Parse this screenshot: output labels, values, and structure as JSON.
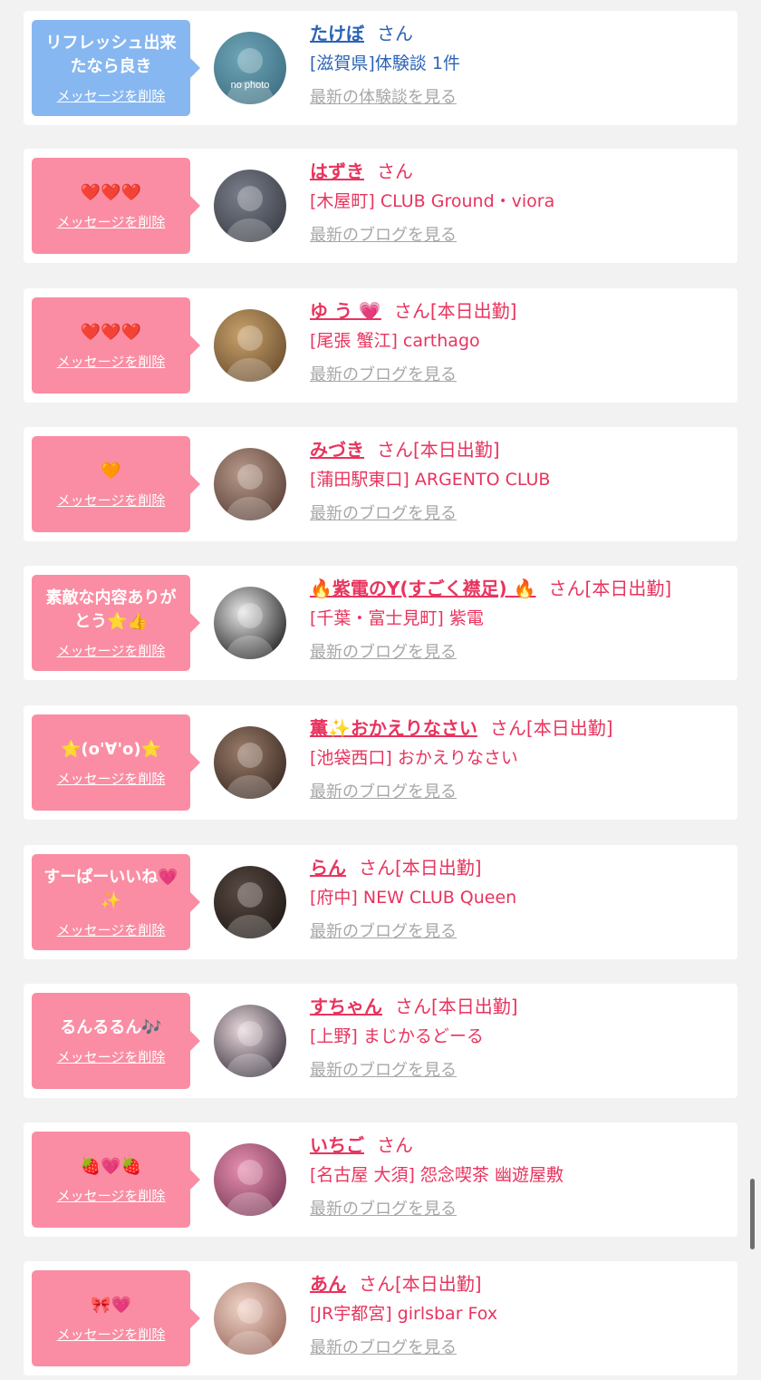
{
  "colors": {
    "background": "#f2f2f2",
    "card": "#ffffff",
    "pink_bubble": "#fa8da3",
    "blue_bubble": "#87b7f0",
    "pink_text": "#e8345e",
    "blue_text": "#2b63b6",
    "link_gray": "#a7a7a7"
  },
  "delete_label": "メッセージを削除",
  "cards": [
    {
      "message": "リフレッシュ出来\nたなら良き",
      "bubble": "blue",
      "avatar_text": "no photo",
      "name": "たけぼ",
      "san": "さん",
      "status": "",
      "detail": "[滋賀県]体験談 1件",
      "link": "最新の体験談を見る",
      "theme": "blue"
    },
    {
      "message": "❤️❤️❤️",
      "bubble": "pink",
      "name": "はずき",
      "san": "さん",
      "status": "",
      "detail": "[木屋町] CLUB Ground・viora",
      "link": "最新のブログを見る",
      "theme": "pink"
    },
    {
      "message": "❤️❤️❤️",
      "bubble": "pink",
      "name": "ゆ う 💗",
      "san": "さん",
      "status": "[本日出勤]",
      "detail": "[尾張 蟹江] carthago",
      "link": "最新のブログを見る",
      "theme": "pink"
    },
    {
      "message": "🧡",
      "bubble": "pink",
      "name": "みづき",
      "san": "さん",
      "status": "[本日出勤]",
      "detail": "[蒲田駅東口] ARGENTO CLUB",
      "link": "最新のブログを見る",
      "theme": "pink"
    },
    {
      "message": "素敵な内容ありが\nとう⭐️👍",
      "bubble": "pink",
      "name": "🔥紫電のY(すごく襟足) 🔥",
      "san": "さん",
      "status": "[本日出勤]",
      "detail": "[千葉・富士見町] 紫電",
      "link": "最新のブログを見る",
      "theme": "pink"
    },
    {
      "message": "⭐️(o'∀'o)⭐️",
      "bubble": "pink",
      "name": "薫✨おかえりなさい",
      "san": "さん",
      "status": "[本日出勤]",
      "detail": "[池袋西口] おかえりなさい",
      "link": "最新のブログを見る",
      "theme": "pink"
    },
    {
      "message": "すーぱーいいね💗\n✨",
      "bubble": "pink",
      "name": "らん",
      "san": "さん",
      "status": "[本日出勤]",
      "detail": "[府中] NEW CLUB Queen",
      "link": "最新のブログを見る",
      "theme": "pink"
    },
    {
      "message": "るんるるん🎶",
      "bubble": "pink",
      "name": "すちゃん",
      "san": "さん",
      "status": "[本日出勤]",
      "detail": "[上野] まじかるどーる",
      "link": "最新のブログを見る",
      "theme": "pink"
    },
    {
      "message": "🍓💗🍓",
      "bubble": "pink",
      "name": "いちご",
      "san": "さん",
      "status": "",
      "detail": "[名古屋 大須] 怨念喫茶 幽遊屋敷",
      "link": "最新のブログを見る",
      "theme": "pink"
    },
    {
      "message": "🎀💗",
      "bubble": "pink",
      "name": "あん",
      "san": "さん",
      "status": "[本日出勤]",
      "detail": "[JR宇都宮] girlsbar Fox",
      "link": "最新のブログを見る",
      "theme": "pink"
    }
  ]
}
